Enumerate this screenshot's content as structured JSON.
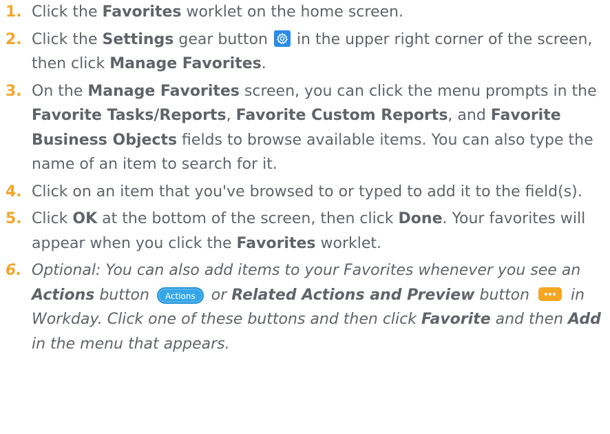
{
  "colors": {
    "step_number": "#f3a52a",
    "body_text": "#606469",
    "gear_button": "#2b8be6",
    "actions_button": "#35a7e8",
    "more_button": "#f5a623"
  },
  "steps": [
    {
      "number": "1.",
      "parts": [
        "Click the ",
        "Favorites",
        " worklet on the home screen."
      ]
    },
    {
      "number": "2.",
      "parts": [
        "Click the ",
        "Settings",
        " gear button ",
        " in the upper right corner of the screen, then click ",
        "Manage Favorites",
        "."
      ],
      "icon": "gear-icon"
    },
    {
      "number": "3.",
      "parts": [
        "On the ",
        "Manage Favorites",
        " screen, you can click the menu prompts in the ",
        "Favorite Tasks/Reports",
        ", ",
        "Favorite Custom Reports",
        ", and ",
        "Favorite Business Objects",
        " fields to browse available items. You can also type the name of an item to search for it."
      ]
    },
    {
      "number": "4.",
      "parts": [
        "Click on an item that you've browsed to or typed to add it to the field(s)."
      ]
    },
    {
      "number": "5.",
      "parts": [
        "Click ",
        "OK",
        " at the bottom of the screen, then click ",
        "Done",
        ". Your favorites will appear when you click the ",
        "Favorites",
        " worklet."
      ]
    },
    {
      "number": "6.",
      "parts": [
        "Optional: You can also add items to your Favorites whenever you see an ",
        "Actions",
        " button ",
        " or ",
        "Related Actions and Preview",
        " button ",
        " in Workday. Click one of these buttons and then click ",
        "Favorite",
        " and then ",
        "Add",
        " in the menu that appears."
      ],
      "actions_button_label": "Actions",
      "more_icon": "ellipsis-icon"
    }
  ]
}
